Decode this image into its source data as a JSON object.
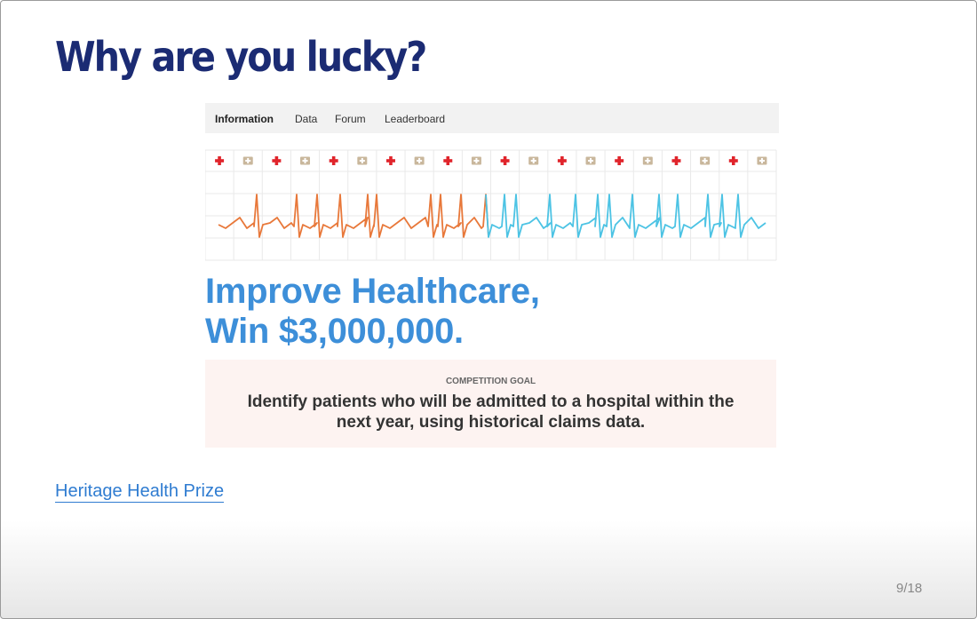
{
  "slide": {
    "title": "Why are you lucky?",
    "page_number": "9/18"
  },
  "screenshot": {
    "nav": {
      "items": [
        "Information",
        "Data",
        "Forum",
        "Leaderboard"
      ],
      "active": "Information"
    },
    "icons": [
      "red-cross-icon",
      "first-aid-kit-icon"
    ],
    "colors": {
      "cross": "#e0242b",
      "kit": "#c9b79c",
      "ekg_orange": "#e8783a",
      "ekg_blue": "#4cc3e4",
      "headline": "#3d8fd9"
    },
    "headline_line1": "Improve Healthcare,",
    "headline_line2": "Win $3,000,000.",
    "goal_label": "COMPETITION GOAL",
    "goal_line1": "Identify patients who will be admitted to a hospital within the",
    "goal_line2": "next year, using historical claims data."
  },
  "link": {
    "text": "Heritage Health Prize"
  }
}
